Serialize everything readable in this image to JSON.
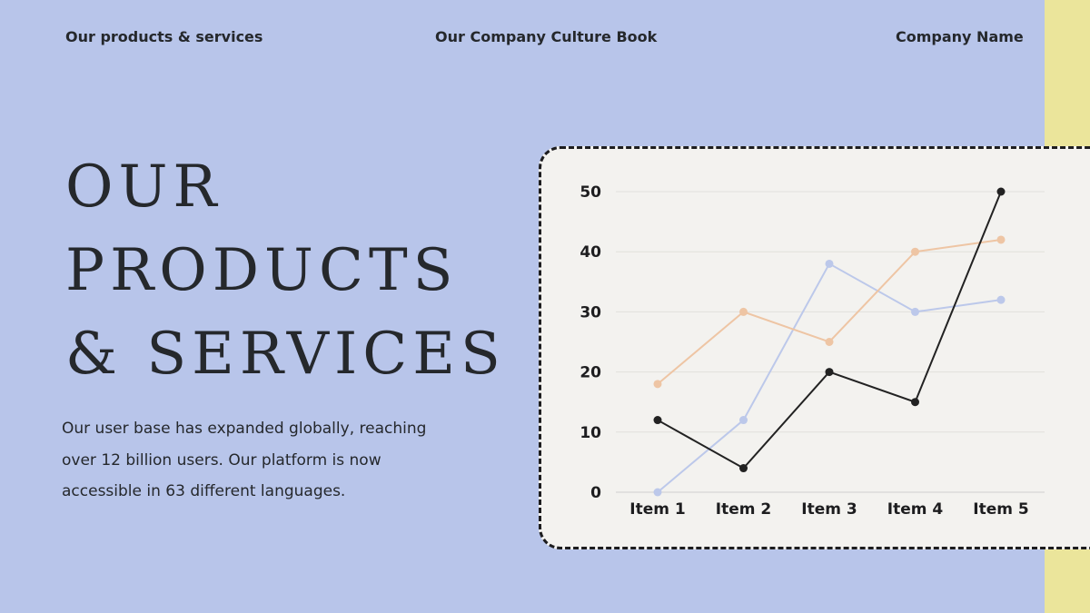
{
  "header": {
    "left": "Our products & services",
    "center": "Our Company Culture Book",
    "right": "Company Name"
  },
  "title_lines": [
    "OUR",
    "PRODUCTS",
    "& SERVICES"
  ],
  "description": "Our user base has expanded globally, reaching over 12 billion users. Our platform is now accessible in 63 different languages.",
  "colors": {
    "background": "#b8c5ea",
    "accent_strip": "#ebe59b",
    "card": "#f3f2ef"
  },
  "chart_data": {
    "type": "line",
    "categories": [
      "Item 1",
      "Item 2",
      "Item 3",
      "Item 4",
      "Item 5"
    ],
    "yticks": [
      0,
      10,
      20,
      30,
      40,
      50
    ],
    "ylim": [
      0,
      50
    ],
    "grid": true,
    "series": [
      {
        "color": "#222222",
        "values": [
          12,
          4,
          20,
          15,
          50
        ]
      },
      {
        "color": "#eec5a4",
        "values": [
          18,
          30,
          25,
          40,
          42
        ]
      },
      {
        "color": "#bcc8ea",
        "values": [
          0,
          12,
          38,
          30,
          32
        ]
      }
    ]
  }
}
